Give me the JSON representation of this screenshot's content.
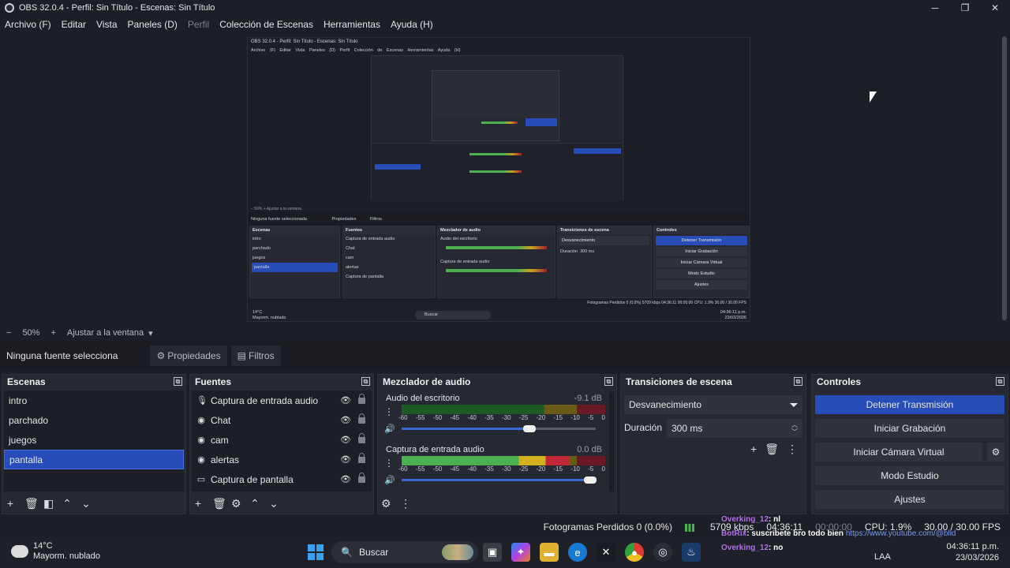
{
  "window": {
    "title": "OBS 32.0.4 - Perfil: Sin Título - Escenas: Sin Título"
  },
  "menu": {
    "items": [
      "Archivo (F)",
      "Editar",
      "Vista",
      "Paneles (D)",
      "Perfil",
      "Colección de Escenas",
      "Herramientas",
      "Ayuda (H)"
    ]
  },
  "nested_preview": {
    "title": "OBS 32.0.4 - Perfil: Sin Título - Escenas: Sin Título",
    "menu": "Archivo (F)  Editar  Vista  Paneles (D)  Perfil  Colección de Escenas  Herramientas  Ayuda (H)",
    "zoom": "−  50%  +  Ajustar a la ventana",
    "no_source": "Ninguna fuente seleccionada",
    "props": "Propiedades",
    "filters": "Filtros",
    "scenes_title": "Escenas",
    "scenes": [
      "intro",
      "parchado",
      "juegos",
      "pantalla"
    ],
    "sources_title": "Fuentes",
    "sources": [
      "Captura de entrada audio",
      "Chat",
      "cam",
      "alertas",
      "Captura de pantalla"
    ],
    "mixer_title": "Mezclador de audio",
    "mixer_ch1": "Audio del escritorio",
    "mixer_ch2": "Captura de entrada audio",
    "trans_title": "Transiciones de escena",
    "trans_value": "Desvanecimiento",
    "trans_dur": "Duración",
    "trans_ms": "300 ms",
    "ctrl_title": "Controles",
    "ctrl": [
      "Detener Transmisión",
      "Iniciar Grabación",
      "Iniciar Cámara Virtual",
      "Modo Estudio",
      "Ajustes"
    ],
    "status": "Fotogramas Perdidos 0 (0.0%)   5709 kbps   04:36:11   00:00:00   CPU: 1.9%   30.00 / 30.00 FPS",
    "search": "Buscar",
    "weather": "14°C\nMayorm. nublado",
    "clock": "04:36:11 p.m.\n23/03/2026"
  },
  "zoombar": {
    "minus": "−",
    "zoom": "50%",
    "plus": "+",
    "fit": "Ajustar a la ventana",
    "arrow": "▾"
  },
  "selection": {
    "none": "Ninguna fuente selecciona",
    "properties": "Propiedades",
    "filters": "Filtros"
  },
  "scenes": {
    "title": "Escenas",
    "items": [
      "intro",
      "parchado",
      "juegos",
      "pantalla"
    ],
    "selected": 3
  },
  "sources": {
    "title": "Fuentes",
    "items": [
      {
        "label": "Captura de entrada audio",
        "icon": "microphone-icon"
      },
      {
        "label": "Chat",
        "icon": "globe-icon"
      },
      {
        "label": "cam",
        "icon": "globe-icon"
      },
      {
        "label": "alertas",
        "icon": "globe-icon"
      },
      {
        "label": "Captura de pantalla",
        "icon": "monitor-icon"
      }
    ]
  },
  "mixer": {
    "title": "Mezclador de audio",
    "channels": [
      {
        "name": "Audio del escritorio",
        "db": "-9.1 dB",
        "level": 0.0,
        "volume": 0.66
      },
      {
        "name": "Captura de entrada audio",
        "db": "0.0 dB",
        "level": 0.82,
        "volume": 0.97
      }
    ],
    "ticks": [
      "-60",
      "-55",
      "-50",
      "-45",
      "-40",
      "-35",
      "-30",
      "-25",
      "-20",
      "-15",
      "-10",
      "-5",
      "0"
    ]
  },
  "transitions": {
    "title": "Transiciones de escena",
    "type": "Desvanecimiento",
    "duration_label": "Duración",
    "duration": "300 ms"
  },
  "controls": {
    "title": "Controles",
    "start_stop_stream": "Detener Transmisión",
    "record": "Iniciar Grabación",
    "virtual_cam": "Iniciar Cámara Virtual",
    "studio": "Modo Estudio",
    "settings": "Ajustes"
  },
  "status": {
    "dropped": "Fotogramas Perdidos 0 (0.0%)",
    "bitrate": "5709 kbps",
    "live": "04:36:11",
    "rec": "00:00:00",
    "cpu": "CPU: 1.9%",
    "fps": "30.00 / 30.00 FPS"
  },
  "chat_overlay": {
    "lines": [
      {
        "user": "Overking_12",
        "text": ": nl"
      },
      {
        "user": "BotRix",
        "text": ": suscribete bro todo bien",
        "link": "https://www.youtube.com/@blld"
      },
      {
        "user": "Overking_12",
        "text": ": no"
      }
    ]
  },
  "taskbar": {
    "weather_temp": "14°C",
    "weather_desc": "Mayorm. nublado",
    "search": "Buscar",
    "lang": "LAA",
    "time": "04:36:11 p.m.",
    "date": "23/03/2026"
  },
  "colors": {
    "accent": "#284cb8",
    "panel": "#262932",
    "background": "#1d1f26"
  }
}
